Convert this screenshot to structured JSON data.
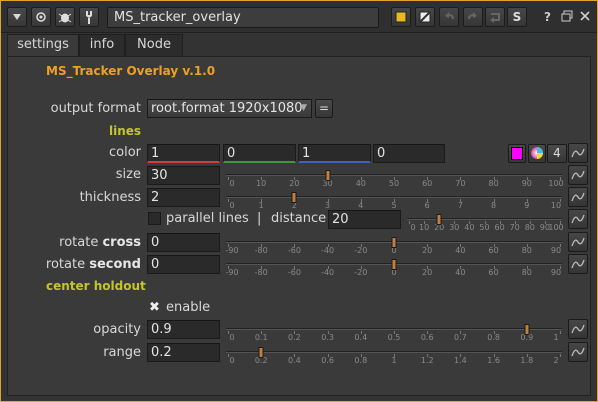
{
  "titlebar": {
    "node_name": "MS_tracker_overlay",
    "icons": [
      "collapse-icon",
      "viewer-icon",
      "bug-icon",
      "wrench-icon"
    ],
    "right_buttons": [
      "?",
      "S"
    ]
  },
  "tabs": [
    {
      "label": "settings",
      "active": true
    },
    {
      "label": "info",
      "active": false
    },
    {
      "label": "Node",
      "active": false
    }
  ],
  "header": {
    "title": "MS_Tracker Overlay v.1.0"
  },
  "output_format": {
    "label": "output format",
    "value": "root.format 1920x1080",
    "edit_button": "="
  },
  "lines": {
    "group_label": "lines",
    "color": {
      "label": "color",
      "r": "1",
      "g": "0",
      "b": "1",
      "a": "0",
      "channels_button": "4",
      "swatch": "#ff00ff"
    },
    "size": {
      "label": "size",
      "value": "30",
      "fraction": 0.3,
      "ticks": [
        "0",
        "10",
        "20",
        "30",
        "40",
        "50",
        "60",
        "70",
        "80",
        "90",
        "100"
      ]
    },
    "thickness": {
      "label": "thickness",
      "value": "2",
      "fraction": 0.2,
      "ticks": [
        "0",
        "1",
        "2",
        "3",
        "4",
        "5",
        "6",
        "7",
        "8",
        "9",
        "10"
      ]
    },
    "parallel": {
      "label": "parallel lines",
      "separator": "|",
      "distance_label": "distance",
      "distance_value": "20",
      "fraction": 0.2,
      "ticks": [
        "0",
        "10",
        "20",
        "30",
        "40",
        "50",
        "60",
        "70",
        "80",
        "90",
        "100"
      ]
    },
    "rotate_cross": {
      "label_plain": "rotate ",
      "label_bold": "cross",
      "value": "0",
      "fraction": 0.5,
      "ticks": [
        "-90",
        "-80",
        "-60",
        "-40",
        "-20",
        "0",
        "20",
        "40",
        "60",
        "80",
        "90"
      ]
    },
    "rotate_second": {
      "label_plain": "rotate ",
      "label_bold": "second",
      "value": "0",
      "fraction": 0.5,
      "ticks": [
        "-90",
        "-80",
        "-60",
        "-40",
        "-20",
        "0",
        "20",
        "40",
        "60",
        "80",
        "90"
      ]
    }
  },
  "center": {
    "group_label": "center holdout",
    "enable_label": "enable",
    "opacity": {
      "label": "opacity",
      "value": "0.9",
      "fraction": 0.9,
      "ticks": [
        "0",
        "0.1",
        "0.2",
        "0.3",
        "0.4",
        "0.5",
        "0.6",
        "0.7",
        "0.8",
        "0.9",
        "1"
      ]
    },
    "range": {
      "label": "range",
      "value": "0.2",
      "fraction": 0.1,
      "ticks": [
        "0",
        "0.2",
        "0.4",
        "0.6",
        "0.8",
        "1",
        "1.2",
        "1.4",
        "1.6",
        "1.8",
        "2"
      ]
    }
  }
}
